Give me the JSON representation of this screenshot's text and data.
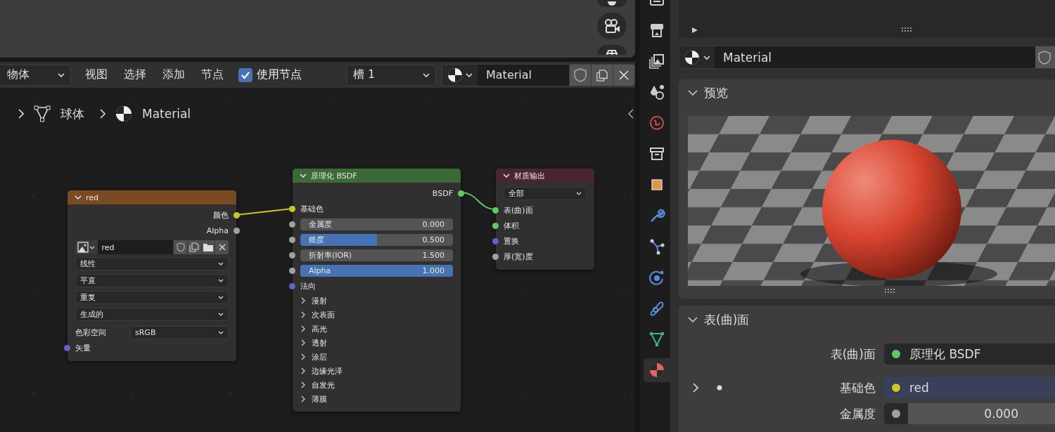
{
  "header": {
    "mode": "物体",
    "menus": [
      "视图",
      "选择",
      "添加",
      "节点"
    ],
    "use_nodes": {
      "label": "使用节点",
      "checked": true
    },
    "slot": "槽 1",
    "material": "Material"
  },
  "breadcrumb": [
    "球体",
    "Material"
  ],
  "image_node": {
    "title": "red",
    "outputs": [
      {
        "label": "颜色",
        "color": "#c7c729"
      },
      {
        "label": "Alpha",
        "color": "#a1a1a1"
      }
    ],
    "image": "red",
    "options": [
      "线性",
      "平直",
      "重复",
      "生成的"
    ],
    "color_space": {
      "label": "色彩空间",
      "value": "sRGB"
    },
    "inputs": [
      {
        "label": "矢量",
        "color": "#6363c7"
      }
    ]
  },
  "bsdf_node": {
    "title": "原理化 BSDF",
    "output": {
      "label": "BSDF",
      "color": "#63c763"
    },
    "rows": [
      {
        "kind": "socket",
        "label": "基础色",
        "color": "#c7c729"
      },
      {
        "kind": "slider",
        "label": "金属度",
        "value": "0.000",
        "level": 0,
        "color": "#a1a1a1"
      },
      {
        "kind": "slider",
        "label": "糙度",
        "value": "0.500",
        "level": 0.5,
        "color": "#a1a1a1"
      },
      {
        "kind": "slider",
        "label": "折射率(IOR)",
        "value": "1.500",
        "level": 0,
        "color": "#a1a1a1"
      },
      {
        "kind": "slider",
        "label": "Alpha",
        "value": "1.000",
        "level": 1,
        "color": "#a1a1a1"
      },
      {
        "kind": "socket",
        "label": "法向",
        "color": "#6363c7"
      }
    ],
    "panels": [
      "漫射",
      "次表面",
      "高光",
      "透射",
      "涂层",
      "边缘光泽",
      "自发光",
      "薄膜"
    ]
  },
  "output_node": {
    "title": "材质输出",
    "target": "全部",
    "inputs": [
      {
        "label": "表(曲)面",
        "color": "#63c763"
      },
      {
        "label": "体积",
        "color": "#63c763"
      },
      {
        "label": "置换",
        "color": "#6363c7"
      },
      {
        "label": "厚(宽)度",
        "color": "#a1a1a1"
      }
    ]
  },
  "properties": {
    "tabs": [
      {
        "kind": "tool",
        "selected": false
      },
      {
        "kind": "output",
        "selected": false
      },
      {
        "kind": "view_layer",
        "selected": false
      },
      {
        "kind": "scene",
        "selected": false
      },
      {
        "kind": "world",
        "selected": false
      },
      {
        "kind": "collection",
        "selected": false
      },
      {
        "kind": "object",
        "selected": false
      },
      {
        "kind": "modifier",
        "selected": false
      },
      {
        "kind": "particles",
        "selected": false
      },
      {
        "kind": "physics",
        "selected": false
      },
      {
        "kind": "constraints",
        "selected": false
      },
      {
        "kind": "data",
        "selected": false
      },
      {
        "kind": "material",
        "selected": true
      }
    ],
    "material": "Material",
    "preview": {
      "title": "预览",
      "expanded": true
    },
    "surface": {
      "title": "表(曲)面",
      "expanded": true,
      "rows": [
        {
          "kind": "link",
          "label": "表(曲)面",
          "value": "原理化 BSDF",
          "color": "#63c763",
          "expandable": false
        },
        {
          "kind": "link",
          "label": "基础色",
          "value": "red",
          "color": "#c7c729",
          "expandable": true
        },
        {
          "kind": "number",
          "label": "金属度",
          "value": "0.000",
          "color": "#a1a1a1",
          "expandable": false
        }
      ]
    }
  }
}
